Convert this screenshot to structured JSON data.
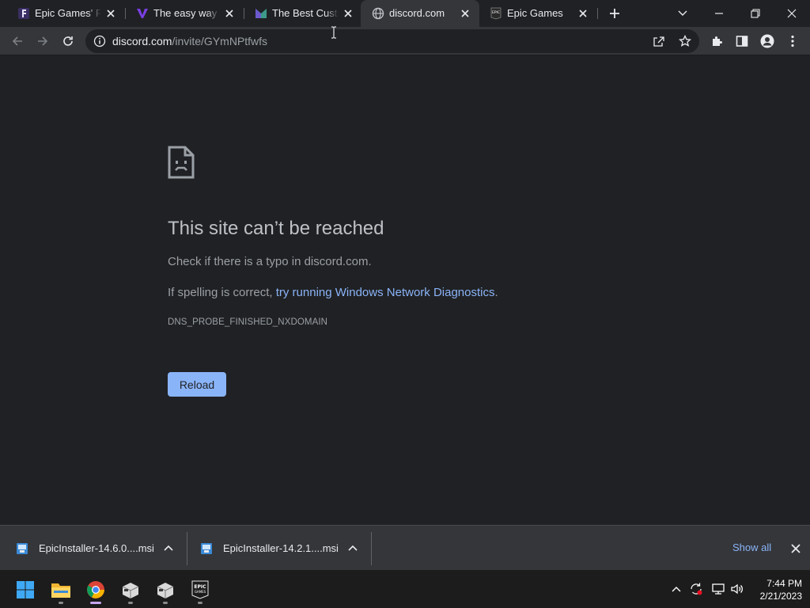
{
  "browser": {
    "tabs": [
      {
        "title": "Epic Games' Fortnite",
        "favicon": "fortnite-icon",
        "active": false
      },
      {
        "title": "The easy way to",
        "favicon": "app-v-icon",
        "active": false
      },
      {
        "title": "The Best Custom",
        "favicon": "app-m-icon",
        "active": false
      },
      {
        "title": "discord.com",
        "favicon": "globe-icon",
        "active": true
      },
      {
        "title": "Epic Games",
        "favicon": "epic-games-icon",
        "active": false
      }
    ],
    "url_domain": "discord.com",
    "url_path": "/invite/GYmNPtfwfs"
  },
  "error_page": {
    "title": "This site can’t be reached",
    "line1": "Check if there is a typo in discord.com.",
    "line2_prefix": "If spelling is correct, ",
    "line2_link": "try running Windows Network Diagnostics",
    "line2_suffix": ".",
    "error_code": "DNS_PROBE_FINISHED_NXDOMAIN",
    "reload_label": "Reload"
  },
  "downloads": {
    "items": [
      {
        "filename": "EpicInstaller-14.6.0....msi"
      },
      {
        "filename": "EpicInstaller-14.2.1....msi"
      }
    ],
    "show_all_label": "Show all"
  },
  "taskbar": {
    "apps": [
      "windows-start-icon",
      "file-explorer-icon",
      "chrome-icon",
      "app-box-icon",
      "app-box-icon",
      "epic-games-icon"
    ],
    "time": "7:44 PM",
    "date": "2/21/2023"
  },
  "colors": {
    "background": "#202124",
    "toolbar": "#35363a",
    "link": "#8ab4f8",
    "button": "#8ab4f8"
  }
}
